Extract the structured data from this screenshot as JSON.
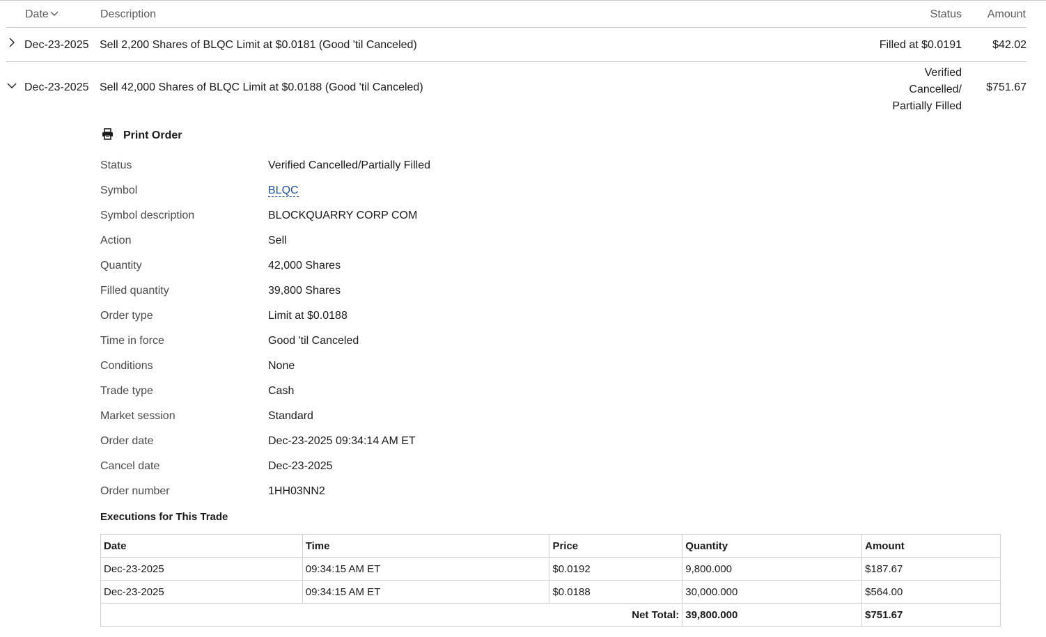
{
  "header": {
    "date": "Date",
    "description": "Description",
    "status": "Status",
    "amount": "Amount"
  },
  "orders": [
    {
      "date": "Dec-23-2025",
      "description": "Sell 2,200 Shares of BLQC Limit at $0.0181 (Good 'til Canceled)",
      "status": "Filled at $0.0191",
      "amount": "$42.02",
      "expanded": false
    },
    {
      "date": "Dec-23-2025",
      "description": "Sell 42,000 Shares of BLQC Limit at $0.0188 (Good 'til Canceled)",
      "status_line1": "Verified",
      "status_line2": "Cancelled/",
      "status_line3": "Partially Filled",
      "amount": "$751.67",
      "expanded": true
    }
  ],
  "detail": {
    "print_label": "Print Order",
    "rows": [
      {
        "label": "Status",
        "value": "Verified Cancelled/Partially Filled"
      },
      {
        "label": "Symbol",
        "value": "BLQC"
      },
      {
        "label": "Symbol description",
        "value": "BLOCKQUARRY CORP COM"
      },
      {
        "label": "Action",
        "value": "Sell"
      },
      {
        "label": "Quantity",
        "value": "42,000 Shares"
      },
      {
        "label": "Filled quantity",
        "value": "39,800 Shares"
      },
      {
        "label": "Order type",
        "value": "Limit at $0.0188"
      },
      {
        "label": "Time in force",
        "value": "Good 'til Canceled"
      },
      {
        "label": "Conditions",
        "value": "None"
      },
      {
        "label": "Trade type",
        "value": "Cash"
      },
      {
        "label": "Market session",
        "value": "Standard"
      },
      {
        "label": "Order date",
        "value": "Dec-23-2025 09:34:14 AM ET"
      },
      {
        "label": "Cancel date",
        "value": "Dec-23-2025"
      },
      {
        "label": "Order number",
        "value": "1HH03NN2"
      }
    ]
  },
  "executions": {
    "title": "Executions for This Trade",
    "columns": [
      "Date",
      "Time",
      "Price",
      "Quantity",
      "Amount"
    ],
    "rows": [
      [
        "Dec-23-2025",
        "09:34:15 AM ET",
        "$0.0192",
        "9,800.000",
        "$187.67"
      ],
      [
        "Dec-23-2025",
        "09:34:15 AM ET",
        "$0.0188",
        "30,000.000",
        "$564.00"
      ]
    ],
    "net_total_label": "Net Total:",
    "net_total_quantity": "39,800.000",
    "net_total_amount": "$751.67"
  },
  "icons": {
    "sort": "chevron-down-icon",
    "collapsed": "chevron-right-icon",
    "expanded": "chevron-down-icon",
    "print": "printer-icon"
  },
  "colors": {
    "link": "#1d4e9e",
    "border": "#cfcfcf",
    "muted_text": "#5a5a5a"
  }
}
